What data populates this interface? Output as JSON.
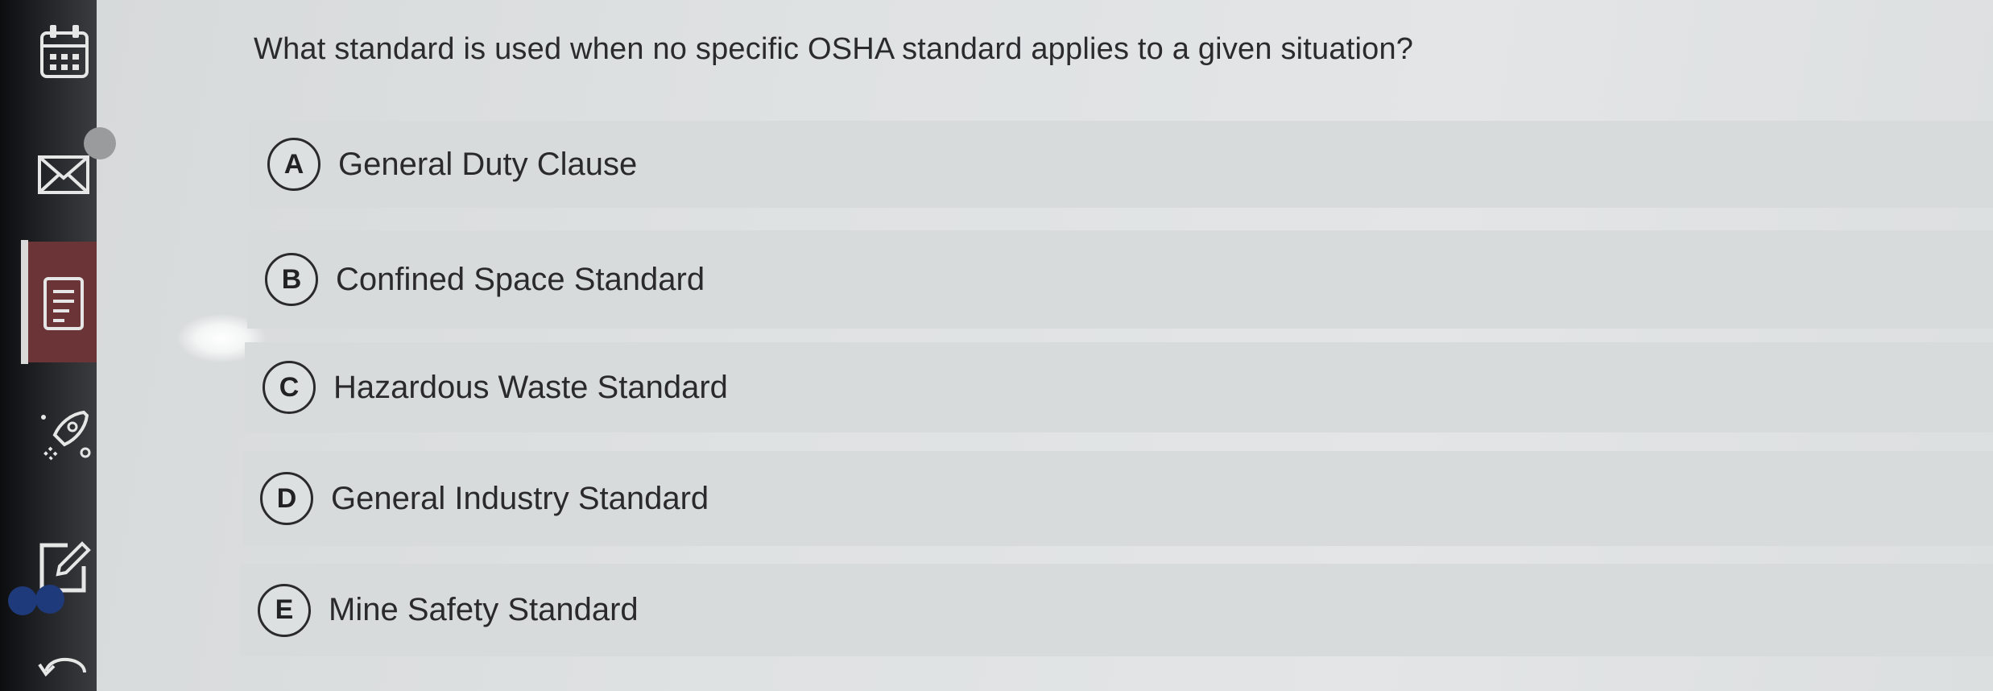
{
  "sidebar": {
    "items": [
      {
        "icon": "calendar-icon"
      },
      {
        "icon": "mail-icon"
      },
      {
        "icon": "document-icon",
        "active": true
      },
      {
        "icon": "rocket-icon"
      },
      {
        "icon": "edit-icon"
      },
      {
        "icon": "back-arrow-icon"
      }
    ],
    "active_color": "#6b3436"
  },
  "question": {
    "text": "What standard is used when no specific OSHA standard applies to a given situation?"
  },
  "options": [
    {
      "letter": "A",
      "text": "General Duty Clause"
    },
    {
      "letter": "B",
      "text": "Confined Space Standard"
    },
    {
      "letter": "C",
      "text": "Hazardous Waste Standard"
    },
    {
      "letter": "D",
      "text": "General Industry Standard"
    },
    {
      "letter": "E",
      "text": "Mine Safety Standard"
    }
  ]
}
